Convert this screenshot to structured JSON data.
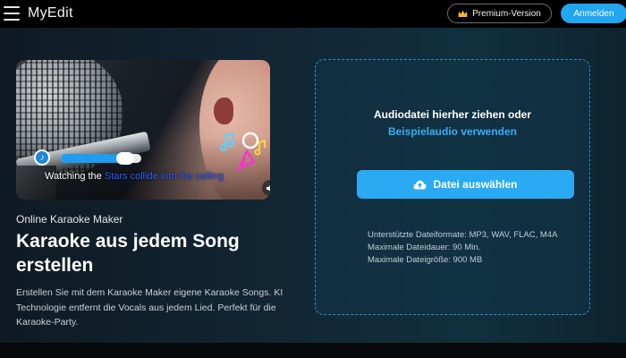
{
  "header": {
    "brand": "MyEdit",
    "premium_label": "Premium-Version",
    "login_label": "Anmelden",
    "menu_icon": "hamburger-menu-icon",
    "crown_icon": "crown-icon"
  },
  "hero": {
    "lyric_white": "Watching the ",
    "lyric_blue": "Stars collide into the ceiling",
    "progress_fraction": 0.8,
    "music_icon": "music-note-icon",
    "mute_icon": "mute-icon"
  },
  "intro": {
    "eyebrow": "Online Karaoke Maker",
    "headline": "Karaoke aus jedem Song erstellen",
    "description": "Erstellen Sie mit dem Karaoke Maker eigene Karaoke Songs. KI Technologie entfernt die Vocals aus jedem Lied. Perfekt für die Karaoke-Party."
  },
  "upload": {
    "drop_text": "Audiodatei hierher ziehen oder",
    "sample_link": "Beispielaudio verwenden",
    "choose_button": "Datei auswählen",
    "upload_icon": "cloud-upload-icon",
    "formats": "Unterstützte Dateiformate: MP3, WAV, FLAC, M4A",
    "max_duration": "Maximale Dateidauer: 90 Min.",
    "max_size": "Maximale Dateigröße: 900 MB"
  },
  "colors": {
    "accent": "#29aaf2",
    "link": "#38aef5",
    "lyric_highlight": "#2f5bff"
  }
}
